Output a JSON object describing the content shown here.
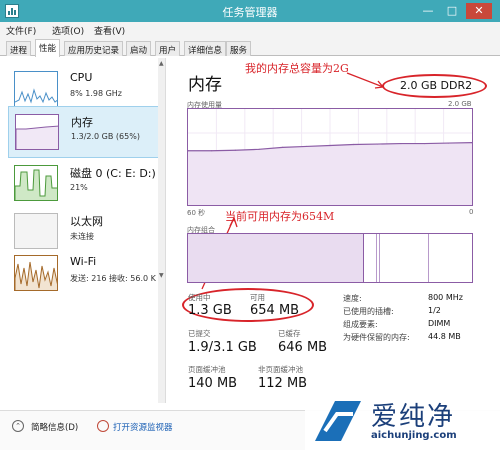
{
  "window": {
    "title": "任务管理器",
    "minimize": "—",
    "maximize": "□",
    "close": "✕"
  },
  "menu": {
    "file": "文件(F)",
    "options": "选项(O)",
    "view": "查看(V)"
  },
  "tabs": [
    "进程",
    "性能",
    "应用历史记录",
    "启动",
    "用户",
    "详细信息",
    "服务"
  ],
  "sidebar": {
    "items": [
      {
        "title": "CPU",
        "sub": "8% 1.98 GHz"
      },
      {
        "title": "内存",
        "sub": "1.3/2.0 GB (65%)"
      },
      {
        "title": "磁盘 0 (C: E: D:)",
        "sub": "21%"
      },
      {
        "title": "以太网",
        "sub": "未连接"
      },
      {
        "title": "Wi-Fi",
        "sub": "发送: 216 接收: 56.0 K"
      }
    ]
  },
  "main": {
    "title": "内存",
    "total": "2.0 GB DDR2",
    "usage_label": "内存使用量",
    "usage_max": "2.0 GB",
    "time_left": "60 秒",
    "time_right": "0",
    "composition_label": "内存组合",
    "stats": {
      "in_use_label": "使用中",
      "in_use": "1.3 GB",
      "available_label": "可用",
      "available": "654 MB",
      "committed_label": "已提交",
      "committed": "1.9/3.1 GB",
      "cached_label": "已缓存",
      "cached": "646 MB",
      "paged_label": "页面缓冲池",
      "paged": "140 MB",
      "nonpaged_label": "非页面缓冲池",
      "nonpaged": "112 MB"
    },
    "info": {
      "speed_label": "速度:",
      "speed": "800 MHz",
      "slots_label": "已使用的插槽:",
      "slots": "1/2",
      "form_label": "组成要素:",
      "form": "DIMM",
      "reserved_label": "为硬件保留的内存:",
      "reserved": "44.8 MB"
    }
  },
  "annotations": {
    "total_note": "我的内存总容量为2G",
    "available_note": "当前可用内存为654M"
  },
  "bottom": {
    "brief": "简略信息(D)",
    "resmon": "打开资源监视器"
  },
  "watermark": {
    "brand": "爱纯净",
    "url": "aichunjing.com"
  },
  "colors": {
    "titlebar": "#3fa9b8",
    "memory": "#8b5ca5",
    "cpu": "#4a90c8",
    "disk": "#4c9a3c",
    "wifi": "#a56a2a",
    "annotation": "#d8242a"
  },
  "chart_data": {
    "type": "area",
    "title": "内存使用量",
    "x": [
      60,
      55,
      50,
      45,
      40,
      35,
      30,
      25,
      20,
      15,
      10,
      5,
      0
    ],
    "values": [
      1.13,
      1.13,
      1.14,
      1.16,
      1.2,
      1.22,
      1.24,
      1.26,
      1.27,
      1.28,
      1.28,
      1.29,
      1.3
    ],
    "ylim": [
      0,
      2.0
    ]
  }
}
